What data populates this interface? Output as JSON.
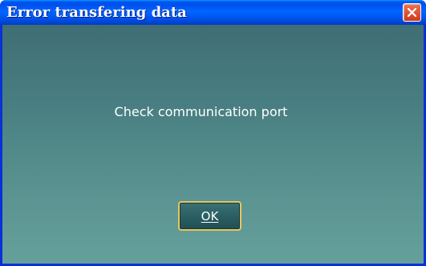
{
  "window": {
    "title": "Error transfering data",
    "close_icon": "close-x-icon"
  },
  "message": {
    "text": "Check communication port"
  },
  "buttons": {
    "ok_label": "OK"
  },
  "colors": {
    "titlebar": "#0055f0",
    "close_button": "#e35a3c",
    "client_top": "#3f6e74",
    "client_bottom": "#66a09b",
    "ok_border": "#e9c561"
  }
}
